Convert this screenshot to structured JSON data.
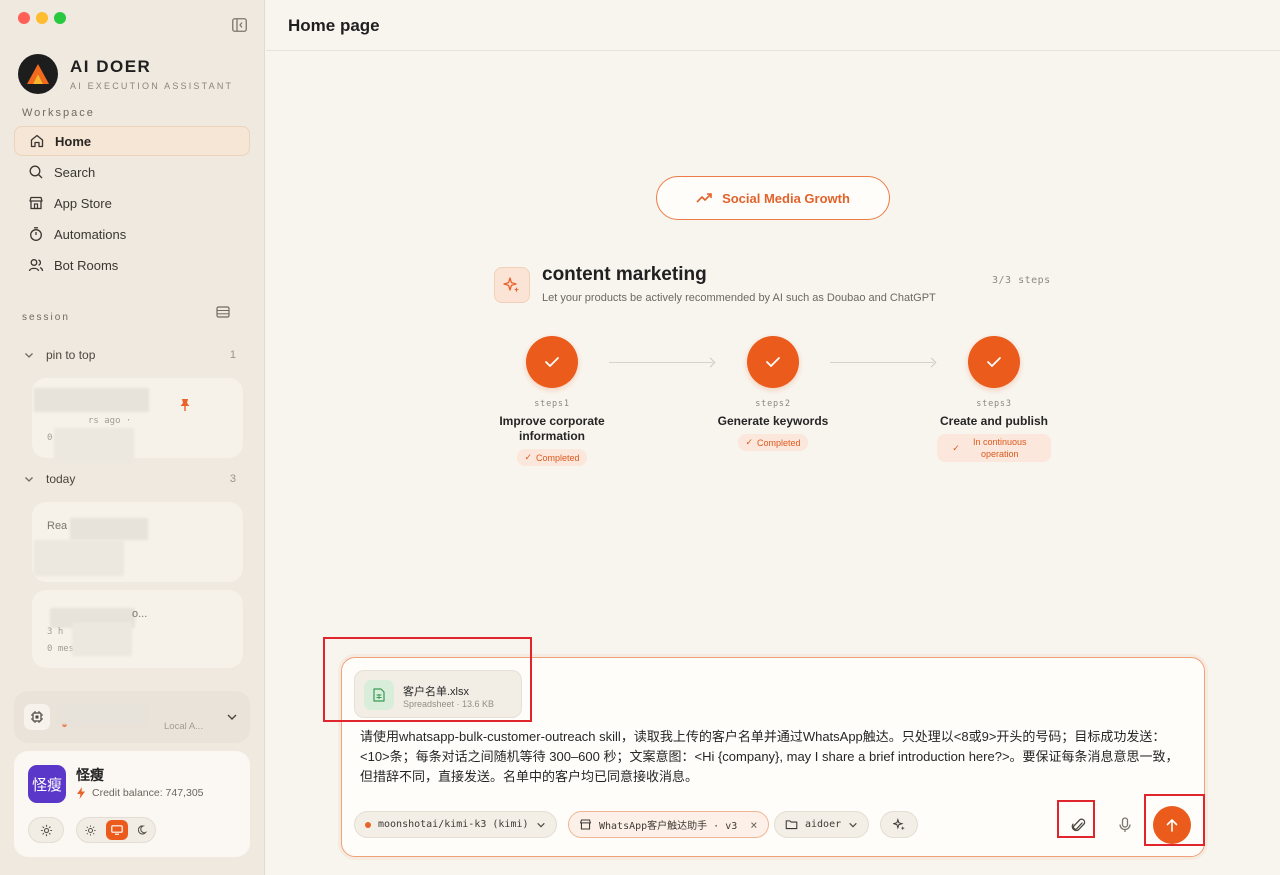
{
  "app": {
    "name": "AI DOER",
    "tagline": "AI EXECUTION ASSISTANT"
  },
  "sidebar": {
    "workspace_label": "Workspace",
    "nav": [
      {
        "label": "Home",
        "icon": "home-icon",
        "active": true
      },
      {
        "label": "Search",
        "icon": "search-icon",
        "active": false
      },
      {
        "label": "App Store",
        "icon": "store-icon",
        "active": false
      },
      {
        "label": "Automations",
        "icon": "timer-icon",
        "active": false
      },
      {
        "label": "Bot Rooms",
        "icon": "users-icon",
        "active": false
      }
    ],
    "session_label": "session",
    "groups": [
      {
        "label": "pin to top",
        "count": "1"
      },
      {
        "label": "today",
        "count": "3"
      }
    ],
    "session_cards": [
      {
        "time_fragment": "rs ago ·",
        "count_fragment": "0 ·    s"
      },
      {
        "title_fragment": "Rea"
      },
      {
        "title_fragment": "o...",
        "time_fragment": "3 h",
        "count_fragment": "0 mes    es"
      }
    ],
    "device": {
      "name_fragment": "Local A..."
    }
  },
  "user": {
    "avatar_text": "怪瘦",
    "name": "怪瘦",
    "credit_label": "Credit balance: 747,305"
  },
  "header": {
    "title": "Home page"
  },
  "main": {
    "category_pill": "Social Media Growth",
    "task": {
      "title": "content marketing",
      "description": "Let your products be actively recommended by AI such as Doubao and ChatGPT",
      "progress": "3/3 steps",
      "steps": [
        {
          "num": "steps1",
          "name": "Improve corporate information",
          "status": "Completed"
        },
        {
          "num": "steps2",
          "name": "Generate keywords",
          "status": "Completed"
        },
        {
          "num": "steps3",
          "name": "Create and publish",
          "status": "In continuous operation"
        }
      ]
    }
  },
  "composer": {
    "attachment": {
      "name": "客户名单.xlsx",
      "meta": "Spreadsheet · 13.6 KB"
    },
    "prompt": "请使用whatsapp-bulk-customer-outreach skill，读取我上传的客户名单并通过WhatsApp触达。只处理以<8或9>开头的号码；目标成功发送：<10>条；每条对话之间随机等待 300–600 秒；文案意图：<Hi {company}, may I share a brief introduction here?>。要保证每条消息意思一致，但措辞不同，直接发送。名单中的客户均已同意接收消息。",
    "model": "moonshotai/kimi-k3 (kimi)",
    "skill": "WhatsApp客户触达助手 · v3",
    "folder": "aidoer"
  },
  "colors": {
    "accent": "#ea5b1c",
    "sidebar_bg": "#efe9df",
    "main_bg": "#f8f5ef",
    "highlight": "#e0262c"
  }
}
